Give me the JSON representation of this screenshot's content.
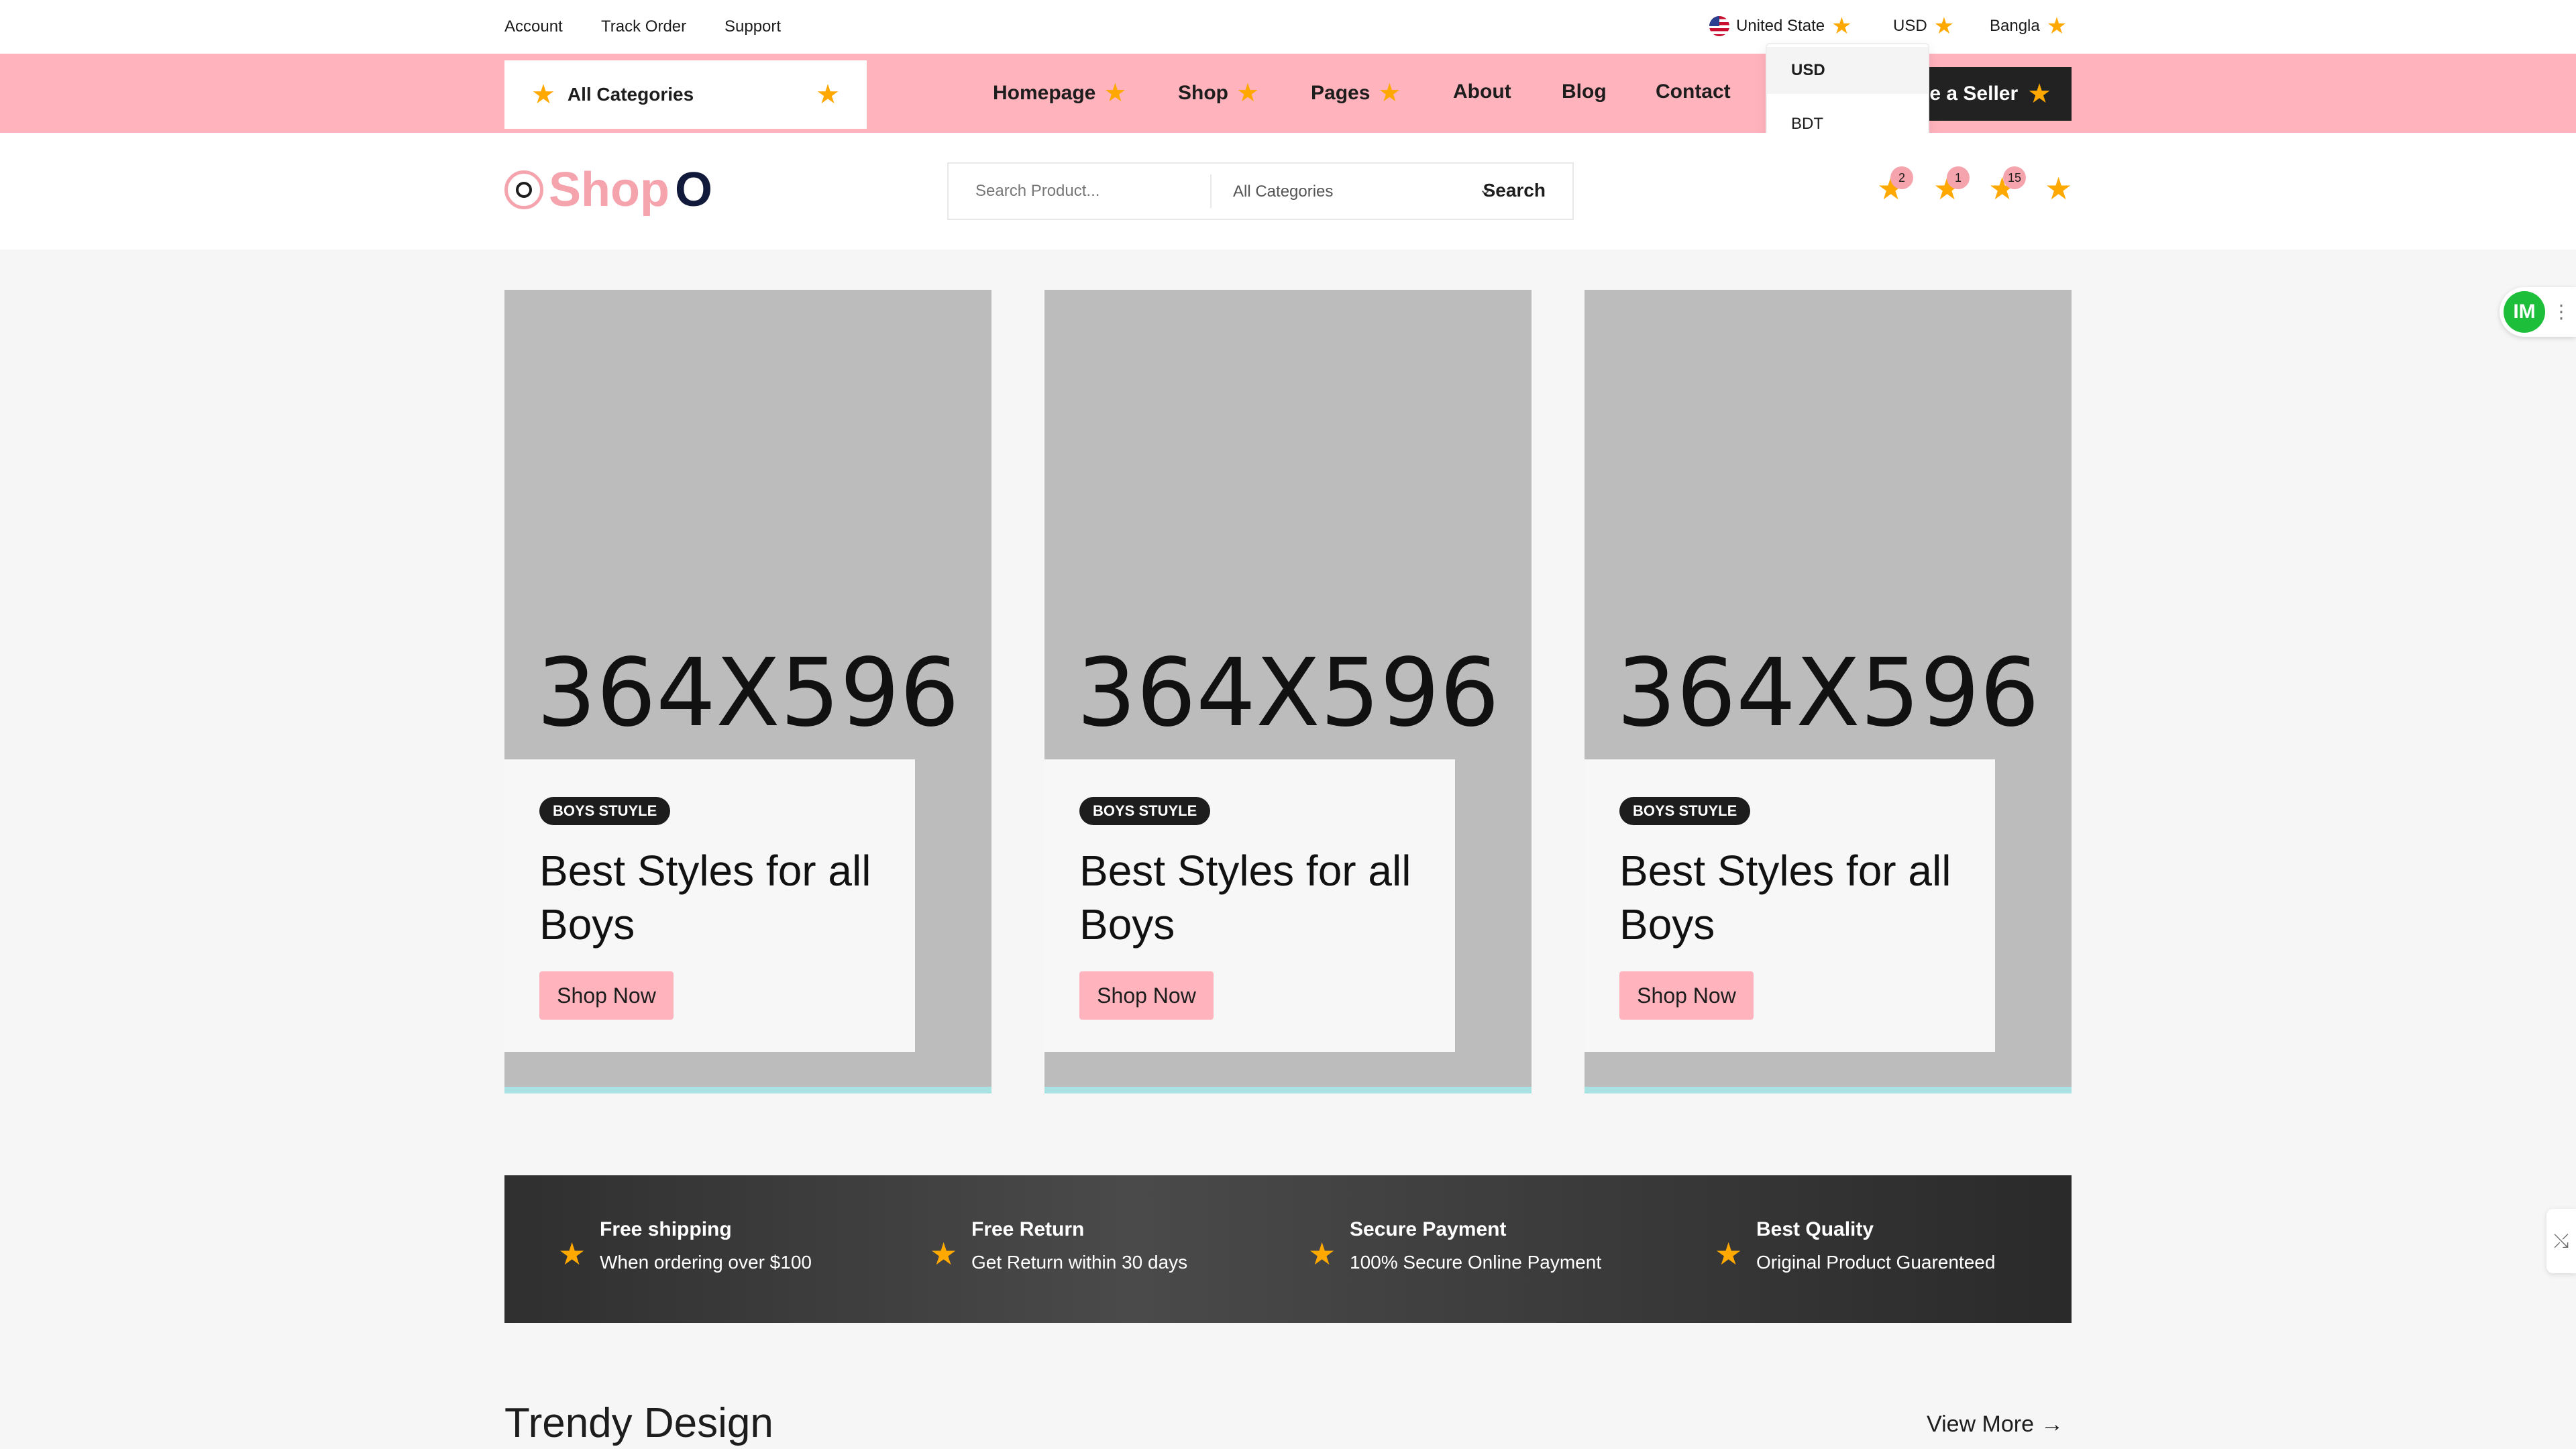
{
  "topbar": {
    "links": [
      "Account",
      "Track Order",
      "Support"
    ],
    "country": "United State",
    "currency": "USD",
    "language": "Bangla"
  },
  "currency_dropdown": {
    "options": [
      "USD",
      "BDT"
    ],
    "selected": "USD"
  },
  "nav": {
    "all_categories": "All Categories",
    "items": [
      "Homepage",
      "Shop",
      "Pages",
      "About",
      "Blog",
      "Contact"
    ],
    "seller_button": "ne a Seller"
  },
  "header": {
    "logo_text": "Shop",
    "logo_suffix": "O",
    "search_placeholder": "Search Product...",
    "search_category": "All Categories",
    "search_button": "Search",
    "badges": [
      "2",
      "1",
      "15"
    ]
  },
  "banners": [
    {
      "placeholder": "364X596",
      "tag": "BOYS STUYLE",
      "title": "Best Styles for all Boys",
      "button": "Shop Now"
    },
    {
      "placeholder": "364X596",
      "tag": "BOYS STUYLE",
      "title": "Best Styles for all Boys",
      "button": "Shop Now"
    },
    {
      "placeholder": "364X596",
      "tag": "BOYS STUYLE",
      "title": "Best Styles for all Boys",
      "button": "Shop Now"
    }
  ],
  "features": [
    {
      "title": "Free shipping",
      "desc": "When ordering over $100"
    },
    {
      "title": "Free Return",
      "desc": "Get Return within 30 days"
    },
    {
      "title": "Secure Payment",
      "desc": "100% Secure Online Payment"
    },
    {
      "title": "Best Quality",
      "desc": "Original Product Guarenteed"
    }
  ],
  "section": {
    "title": "Trendy Design",
    "view_more": "View More"
  },
  "widgets": {
    "im_label": "IM"
  },
  "colors": {
    "accent_pink": "#ffb3bd",
    "star": "#ffa800",
    "dark": "#222222",
    "banner_bar": "#a8e2e3"
  }
}
